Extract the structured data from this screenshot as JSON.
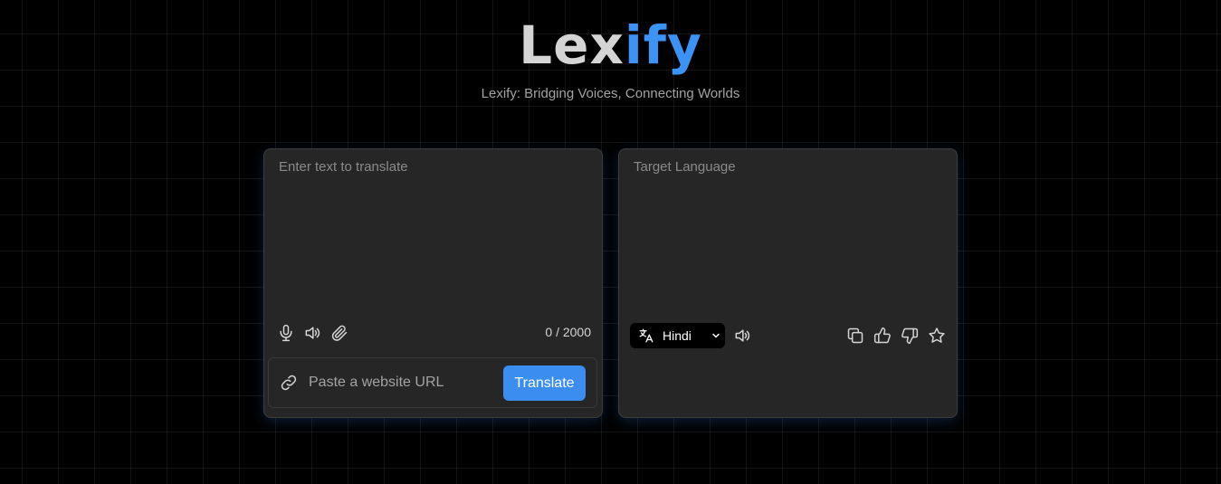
{
  "brand": {
    "part_a": "Lex",
    "part_b": "ify"
  },
  "tagline": "Lexify: Bridging Voices, Connecting Worlds",
  "input_panel": {
    "placeholder": "Enter text to translate",
    "counter": "0 / 2000",
    "icons": [
      "microphone-icon",
      "speaker-icon",
      "paperclip-icon"
    ]
  },
  "url_bar": {
    "placeholder": "Paste a website URL",
    "button_label": "Translate",
    "icon": "link-icon"
  },
  "output_panel": {
    "placeholder": "Target Language",
    "language": "Hindi",
    "icons": [
      "translate-icon",
      "speaker-icon",
      "copy-icon",
      "thumbs-up-icon",
      "thumbs-down-icon",
      "star-icon"
    ]
  },
  "colors": {
    "accent": "#3b8ef0",
    "background": "#000000",
    "panel": "#262626"
  }
}
